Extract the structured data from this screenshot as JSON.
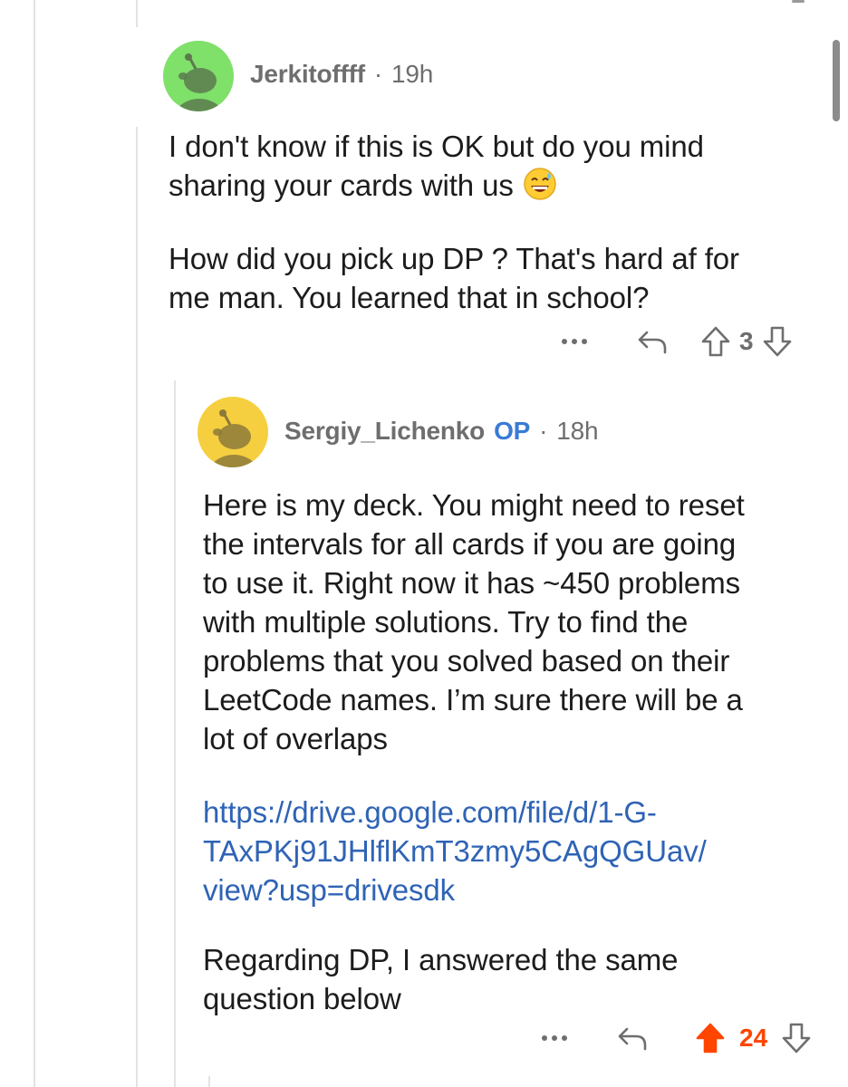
{
  "comments": [
    {
      "author": "Jerkitoffff",
      "time": "19h",
      "avatar_color": "#7fe06a",
      "body": [
        [
          "I don't know if this is OK but do you mind",
          "sharing your cards with us"
        ],
        [
          "How did you pick up DP ? That's hard af for",
          "me man. You learned that in school?"
        ]
      ],
      "emoji": "grinning-sweat-emoji",
      "score": "3",
      "voted": false
    },
    {
      "author": "Sergiy_Lichenko",
      "badge": "OP",
      "time": "18h",
      "avatar_color": "#f5cf3f",
      "body": [
        [
          "Here is my deck. You might need to reset",
          "the intervals for all cards if you are going",
          "to use it. Right now it has ~450 problems",
          "with multiple solutions. Try to find the",
          "problems that you solved based on their",
          "LeetCode names. I’m sure there will be a",
          "lot of overlaps"
        ],
        [
          "https://drive.google.com/file/d/1-G-",
          "TAxPKj91JHlflKmT3zmy5CAgQGUav/",
          "view?usp=drivesdk"
        ],
        [
          "Regarding DP, I answered the same",
          "question below"
        ]
      ],
      "score": "24",
      "voted": true
    }
  ],
  "meta_separator": "·",
  "more_label": "···",
  "colors": {
    "upvote_active": "#ff4500",
    "link": "#2f63b5",
    "op_badge": "#3a7bd5",
    "meta_text": "#6e6e6e"
  },
  "icons": [
    "snoo-avatar-icon",
    "more-options-icon",
    "reply-icon",
    "upvote-icon",
    "downvote-icon"
  ]
}
